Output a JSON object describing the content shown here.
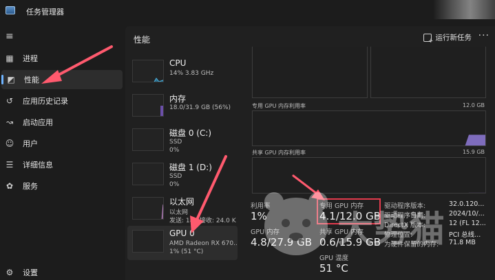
{
  "window": {
    "title": "任务管理器"
  },
  "sidebar": {
    "items": [
      {
        "label": "进程",
        "icon": "processes-icon",
        "glyph": "▦"
      },
      {
        "label": "性能",
        "icon": "performance-icon",
        "glyph": "◩"
      },
      {
        "label": "应用历史记录",
        "icon": "history-icon",
        "glyph": "↺"
      },
      {
        "label": "启动应用",
        "icon": "startup-icon",
        "glyph": "↝"
      },
      {
        "label": "用户",
        "icon": "users-icon",
        "glyph": "☺"
      },
      {
        "label": "详细信息",
        "icon": "details-icon",
        "glyph": "☰"
      },
      {
        "label": "服务",
        "icon": "services-icon",
        "glyph": "✿"
      }
    ],
    "settings_label": "设置"
  },
  "header": {
    "title": "性能",
    "run_task_label": "运行新任务",
    "more_label": "···"
  },
  "resources": [
    {
      "name": "CPU",
      "line1": "14% 3.83 GHz",
      "line2": ""
    },
    {
      "name": "内存",
      "line1": "18.0/31.9 GB (56%)",
      "line2": ""
    },
    {
      "name": "磁盘 0 (C:)",
      "line1": "SSD",
      "line2": "0%"
    },
    {
      "name": "磁盘 1 (D:)",
      "line1": "SSD",
      "line2": "0%"
    },
    {
      "name": "以太网",
      "line1": "以太网",
      "line2": "发送: 184 接收: 24.0 K"
    },
    {
      "name": "GPU 0",
      "line1": "AMD Radeon RX 670..",
      "line2": "1% (51 °C)"
    }
  ],
  "graphs": {
    "dedicated_label": "专用 GPU 内存利用率",
    "dedicated_max": "12.0 GB",
    "shared_label": "共享 GPU 内存利用率",
    "shared_max": "15.9 GB"
  },
  "stats": {
    "utilization_title": "利用率",
    "utilization_value": "1%",
    "dedicated_title": "专用 GPU 内存",
    "dedicated_value": "4.1/12.0 GB",
    "gpu_memory_title": "GPU 内存",
    "gpu_memory_value": "4.8/27.9 GB",
    "shared_title": "共享 GPU 内存",
    "shared_value": "0.6/15.9 GB",
    "temp_title": "GPU 温度",
    "temp_value": "51 °C"
  },
  "info": [
    {
      "key": "驱动程序版本:",
      "value": "32.0.120..."
    },
    {
      "key": "驱动程序日期:",
      "value": "2024/10/..."
    },
    {
      "key": "DirectX 版本:",
      "value": "12 (FL 12..."
    },
    {
      "key": "物理位置:",
      "value": "PCI 总线..."
    },
    {
      "key": "为硬件保留的内存:",
      "value": "71.8 MB"
    }
  ],
  "watermark": {
    "text": "大势猫"
  },
  "colors": {
    "accent": "#6fb4ff",
    "highlight": "#e53b4d",
    "arrow": "#ff5a6e",
    "gpu_fill": "#8f7ad8"
  },
  "levels": {
    "dedicated_used_fraction": 0.34,
    "shared_used_fraction": 0.04
  }
}
